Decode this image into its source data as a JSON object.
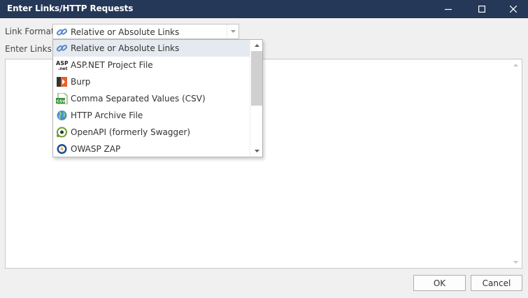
{
  "window": {
    "title": "Enter Links/HTTP Requests",
    "titlebar_color": "#253858",
    "controls": [
      "minimize-icon",
      "maximize-icon",
      "close-icon"
    ]
  },
  "form": {
    "link_format_label": "Link Format",
    "enter_links_label": "Enter Links o",
    "selected_format": "Relative or Absolute Links",
    "selected_icon": "link-icon",
    "textarea_value": ""
  },
  "dropdown": {
    "items": [
      {
        "label": "Relative or Absolute Links",
        "icon": "link-icon",
        "selected": true
      },
      {
        "label": "ASP.NET Project File",
        "icon": "aspnet-icon",
        "selected": false
      },
      {
        "label": "Burp",
        "icon": "burp-icon",
        "selected": false
      },
      {
        "label": "Comma Separated Values (CSV)",
        "icon": "csv-icon",
        "selected": false
      },
      {
        "label": "HTTP Archive File",
        "icon": "globe-icon",
        "selected": false
      },
      {
        "label": "OpenAPI (formerly Swagger)",
        "icon": "openapi-icon",
        "selected": false
      },
      {
        "label": "OWASP ZAP",
        "icon": "zap-icon",
        "selected": false
      }
    ]
  },
  "buttons": {
    "ok": "OK",
    "cancel": "Cancel"
  }
}
